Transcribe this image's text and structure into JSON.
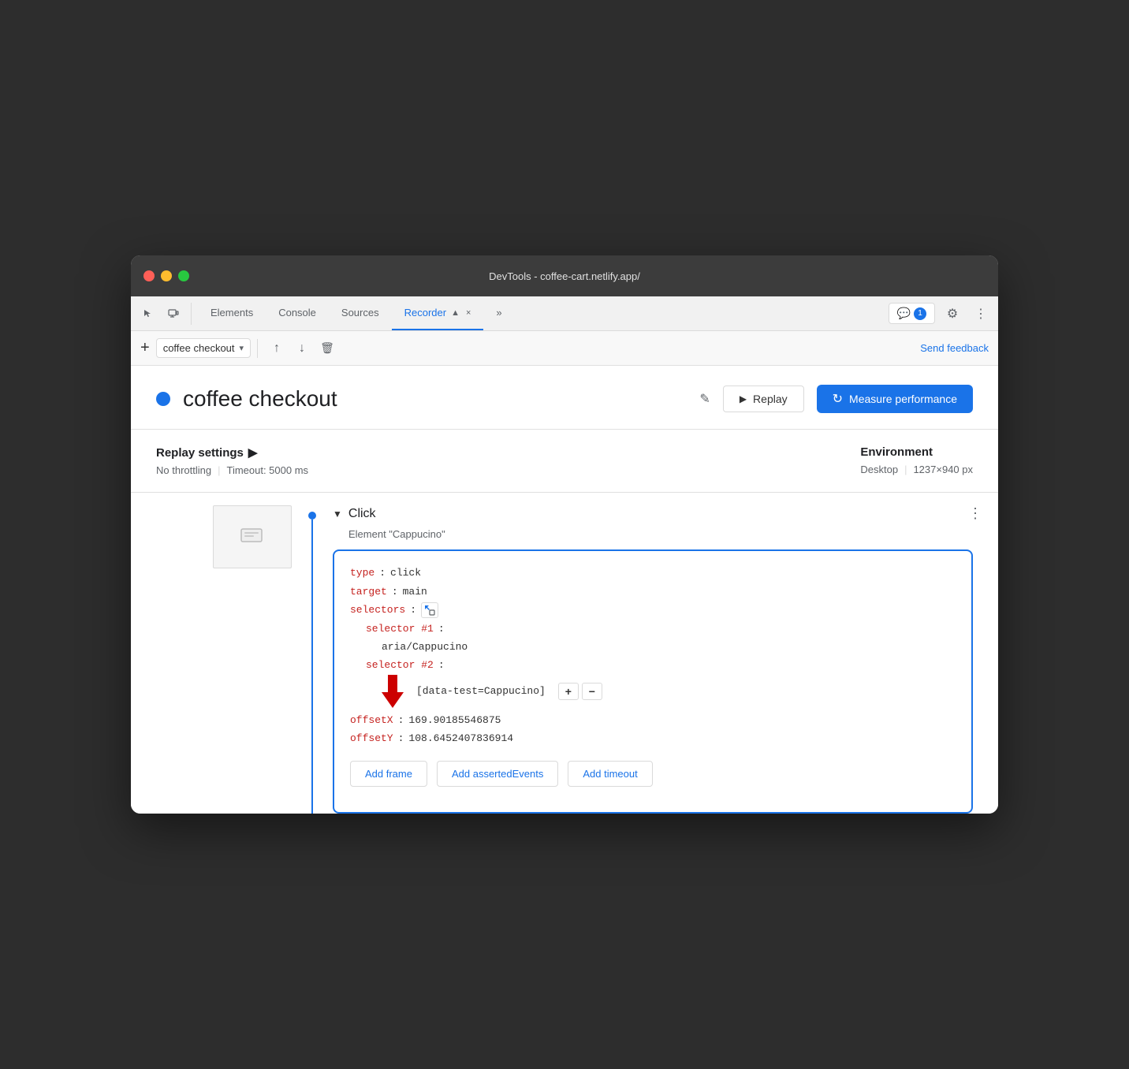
{
  "window": {
    "title": "DevTools - coffee-cart.netlify.app/"
  },
  "traffic_lights": {
    "close": "close",
    "minimize": "minimize",
    "maximize": "maximize"
  },
  "tabs": {
    "items": [
      {
        "label": "Elements",
        "active": false
      },
      {
        "label": "Console",
        "active": false
      },
      {
        "label": "Sources",
        "active": false
      },
      {
        "label": "Recorder",
        "active": true
      },
      {
        "label": "×",
        "active": false
      }
    ],
    "more_label": "»",
    "badge_count": "1",
    "settings_label": "⚙",
    "more_options_label": "⋮"
  },
  "toolbar": {
    "add_label": "+",
    "recording_name": "coffee checkout",
    "chevron": "▾",
    "upload_label": "↑",
    "download_label": "↓",
    "delete_label": "🗑",
    "send_feedback_label": "Send feedback"
  },
  "recording_header": {
    "title": "coffee checkout",
    "edit_icon": "✎",
    "replay_label": "Replay",
    "play_icon": "▶",
    "measure_label": "Measure performance",
    "measure_icon": "↻"
  },
  "settings": {
    "replay_settings_label": "Replay settings",
    "arrow": "▶",
    "throttling_label": "No throttling",
    "timeout_label": "Timeout: 5000 ms",
    "environment_label": "Environment",
    "desktop_label": "Desktop",
    "resolution_label": "1237×940 px"
  },
  "step": {
    "type": "Click",
    "description": "Element \"Cappucino\"",
    "more_icon": "⋮",
    "chevron": "▼",
    "code": {
      "type_key": "type",
      "type_val": "click",
      "target_key": "target",
      "target_val": "main",
      "selectors_key": "selectors",
      "selector1_key": "selector #1",
      "selector1_val": "aria/Cappucino",
      "selector2_key": "selector #2",
      "selector2_val": "[data-test=Cappucino]",
      "offsetX_key": "offsetX",
      "offsetX_val": "169.90185546875",
      "offsetY_key": "offsetY",
      "offsetY_val": "108.6452407836914"
    },
    "add_frame_label": "Add frame",
    "add_asserted_label": "Add assertedEvents",
    "add_timeout_label": "Add timeout"
  }
}
